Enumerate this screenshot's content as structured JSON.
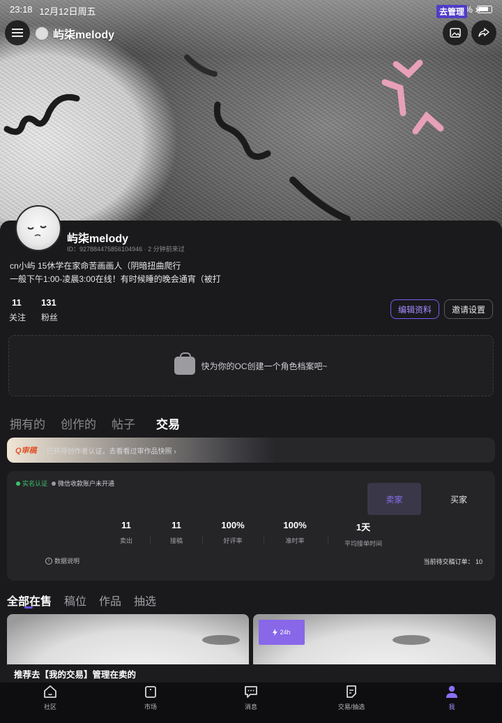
{
  "status_bar": {
    "time": "23:18",
    "date": "12月12日周五",
    "battery": "83%"
  },
  "header": {
    "username": "屿柒melody"
  },
  "profile": {
    "name": "屿柒melody",
    "meta": "ID：927884475856104946 · 2 分钟前来过",
    "bio_line1": "cn小屿 15休学在家命苦画画人（阴暗扭曲爬行",
    "bio_line2": "一般下午1:00-凌晨3:00在线！有时候睡的晚会通宵（被打",
    "following_count": "11",
    "following_label": "关注",
    "followers_count": "131",
    "followers_label": "粉丝",
    "edit_button": "编辑资料",
    "invite_button": "邀请设置"
  },
  "oc_prompt": "快为你的OC创建一个角色档案吧~",
  "tabs": [
    {
      "label": "拥有的"
    },
    {
      "label": "创作的"
    },
    {
      "label": "帖子"
    },
    {
      "label": "交易"
    }
  ],
  "cert_banner": {
    "logo": "Q审稿",
    "text": "已获得创作者认证，去看看过审作品快照 ›"
  },
  "trade": {
    "badge_realname": "实名认证",
    "badge_wechat": "微信收款账户未开通",
    "seller_tab": "卖家",
    "buyer_tab": "买家",
    "stats": [
      {
        "value": "11",
        "label": "卖出"
      },
      {
        "value": "11",
        "label": "接稿"
      },
      {
        "value": "100%",
        "label": "好评率"
      },
      {
        "value": "100%",
        "label": "准时率"
      },
      {
        "value": "1天",
        "label": "平均接单时间"
      }
    ],
    "data_note": "数据说明",
    "pending_orders": "当前待交稿订单：  10"
  },
  "subtabs": [
    {
      "label": "全部在售"
    },
    {
      "label": "稿位"
    },
    {
      "label": "作品"
    },
    {
      "label": "抽选"
    }
  ],
  "product_tag": "24h",
  "promo": {
    "text": "推荐去【我的交易】管理在卖的",
    "button": "去管理",
    "close": "×"
  },
  "bottom_nav": [
    {
      "label": "社区",
      "icon": "home-icon"
    },
    {
      "label": "市场",
      "icon": "shop-bag-icon"
    },
    {
      "label": "消息",
      "icon": "message-icon"
    },
    {
      "label": "交易/抽选",
      "icon": "trade-icon"
    },
    {
      "label": "我",
      "icon": "person-icon"
    }
  ],
  "colors": {
    "accent": "#7a5cf5",
    "card_bg": "#1a1a1c",
    "panel_bg": "#252528"
  }
}
